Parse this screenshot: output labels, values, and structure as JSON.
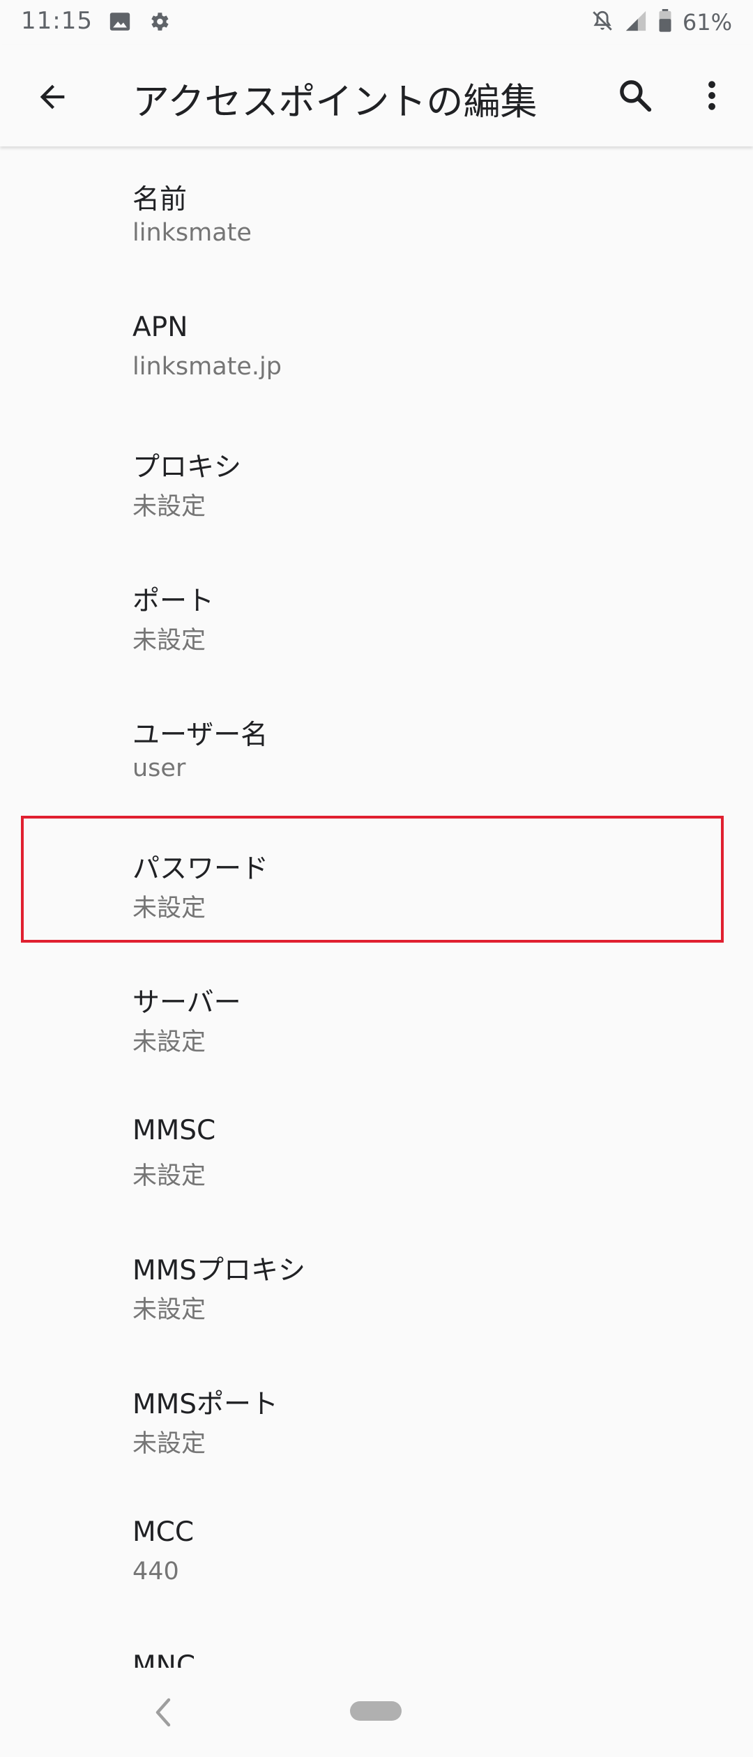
{
  "status_bar": {
    "time": "11:15",
    "battery": "61%",
    "icons": [
      "image-icon",
      "gear-icon",
      "notifications-off-icon",
      "signal-icon",
      "battery-icon"
    ]
  },
  "toolbar": {
    "title": "アクセスポイントの編集",
    "icons": [
      "back-arrow-icon",
      "search-icon",
      "more-vert-icon"
    ]
  },
  "items": [
    {
      "label": "名前",
      "value": "linksmate"
    },
    {
      "label": "APN",
      "value": "linksmate.jp"
    },
    {
      "label": "プロキシ",
      "value": "未設定"
    },
    {
      "label": "ポート",
      "value": "未設定"
    },
    {
      "label": "ユーザー名",
      "value": "user"
    },
    {
      "label": "パスワード",
      "value": "未設定"
    },
    {
      "label": "サーバー",
      "value": "未設定"
    },
    {
      "label": "MMSC",
      "value": "未設定"
    },
    {
      "label": "MMSプロキシ",
      "value": "未設定"
    },
    {
      "label": "MMSポート",
      "value": "未設定"
    },
    {
      "label": "MCC",
      "value": "440"
    },
    {
      "label": "MNC"
    }
  ],
  "colors": {
    "background": "#fafafa",
    "highlight_border": "#e02030",
    "secondary_text": "#757575"
  },
  "navbar": {
    "icons": [
      "nav-back-icon",
      "home-pill-icon"
    ]
  }
}
